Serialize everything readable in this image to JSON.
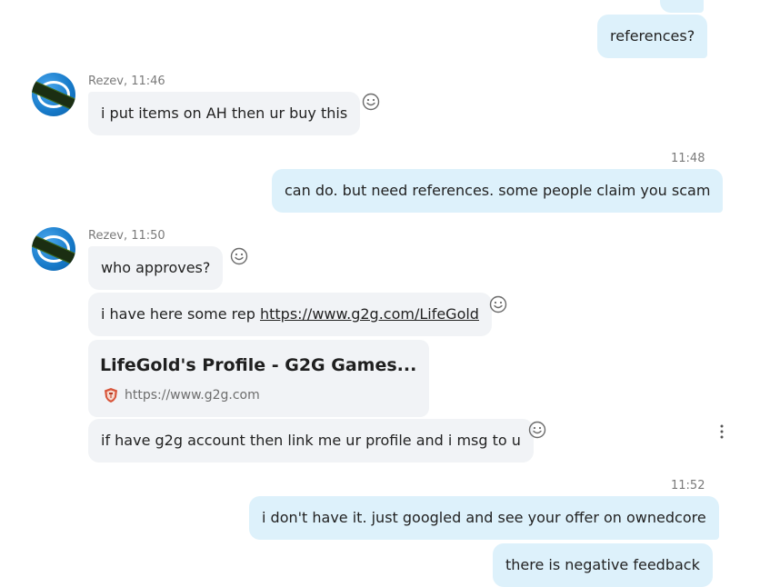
{
  "messages": {
    "m1": {
      "text": "references?"
    },
    "g1": {
      "sender": "Rezev, 11:46",
      "m1": "i put items on AH then ur buy this"
    },
    "t1": "11:48",
    "m2": {
      "text": "can do. but need references. some people claim you scam"
    },
    "g2": {
      "sender": "Rezev, 11:50",
      "m1": "who approves?",
      "m2_prefix": "i have here some rep ",
      "m2_link": "https://www.g2g.com/LifeGold",
      "card_title": "LifeGold's Profile - G2G Games...",
      "card_url": "https://www.g2g.com",
      "m3": "if have g2g account then link me ur profile and i msg to u"
    },
    "t2": "11:52",
    "m3": {
      "text": "i don't have it. just googled and see your offer on ownedcore"
    },
    "m4": {
      "text": "there is negative feedback"
    }
  },
  "icons": {
    "reaction": "smiley-icon",
    "more": "more-vertical-icon",
    "favicon": "g2g-shield-icon",
    "avatar": "skype-logo-avatar"
  },
  "colors": {
    "outgoing_bubble": "#ddf1fb",
    "incoming_bubble": "#f1f3f6",
    "timestamp": "#7a7a7a"
  }
}
